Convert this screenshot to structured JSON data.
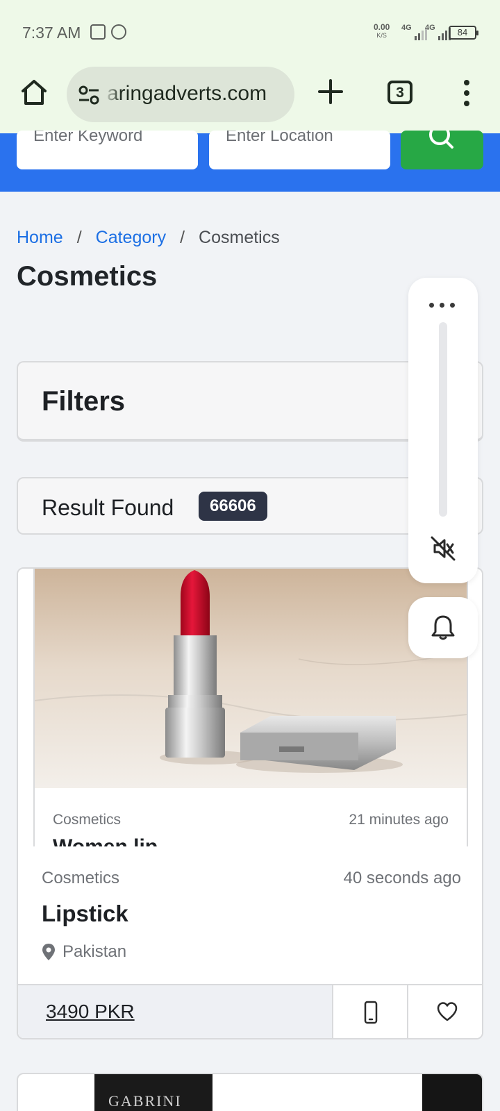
{
  "status_bar": {
    "time": "7:37 AM",
    "net_speed": "0.00",
    "net_unit": "K/S",
    "sim1": "4G",
    "sim2": "4G",
    "battery": "84"
  },
  "browser": {
    "url": "aringadverts.com",
    "tab_count": "3"
  },
  "search": {
    "keyword_placeholder": "Enter Keyword",
    "location_placeholder": "Enter Location"
  },
  "breadcrumb": {
    "home": "Home",
    "category": "Category",
    "current": "Cosmetics",
    "separator": "/"
  },
  "page": {
    "title": "Cosmetics",
    "filters_title": "Filters",
    "result_label": "Result Found",
    "result_count": "66606"
  },
  "listing_behind": {
    "category": "Cosmetics",
    "time": "21 minutes ago",
    "title": "Women lip"
  },
  "listing": {
    "category": "Cosmetics",
    "time": "40 seconds ago",
    "title": "Lipstick",
    "location": "Pakistan",
    "price": "3490 PKR"
  },
  "next_listing": {
    "image_text": "GABRINI"
  },
  "colors": {
    "brand_blue": "#2a72ee",
    "search_green": "#27a845",
    "link_blue": "#1c6fe4",
    "badge_dark": "#2e3446"
  }
}
